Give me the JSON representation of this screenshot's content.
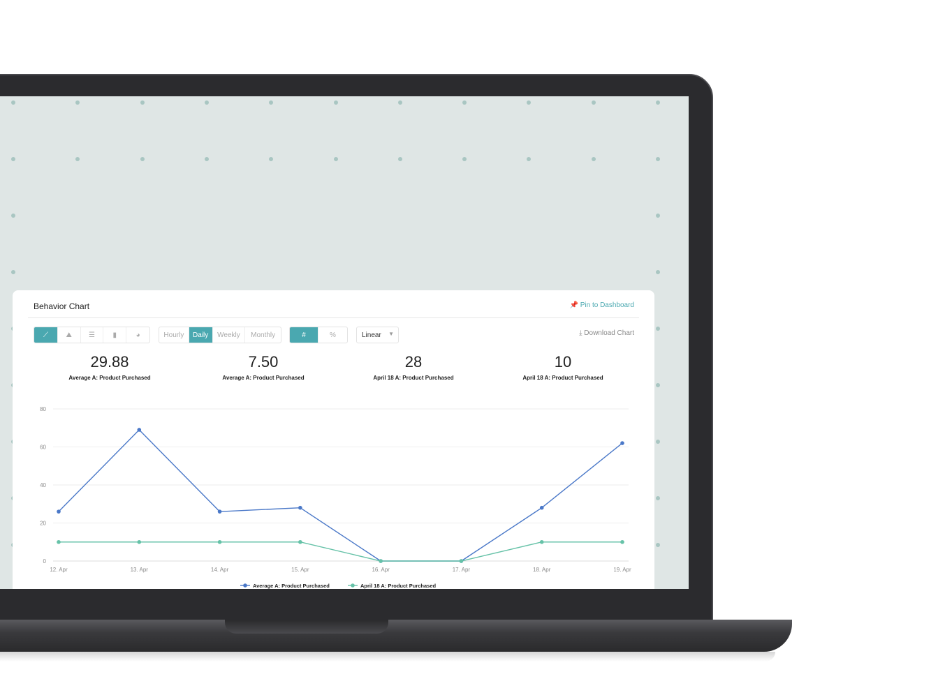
{
  "card": {
    "title": "Behavior Chart",
    "pin_label": "Pin to Dashboard",
    "download_label": "Download Chart"
  },
  "chart_types": [
    "line-chart-icon",
    "area-chart-icon",
    "table-icon",
    "bar-chart-icon",
    "pie-chart-icon"
  ],
  "intervals": [
    "Hourly",
    "Daily",
    "Weekly",
    "Monthly"
  ],
  "active_interval": "Daily",
  "units": [
    "#",
    "%"
  ],
  "active_unit": "#",
  "scale": "Linear",
  "stats": [
    {
      "value": "29.88",
      "label": "Average A: Product Purchased"
    },
    {
      "value": "7.50",
      "label": "Average A: Product Purchased"
    },
    {
      "value": "28",
      "label": "April 18 A: Product Purchased"
    },
    {
      "value": "10",
      "label": "April 18 A: Product Purchased"
    }
  ],
  "chart_data": {
    "type": "line",
    "categories": [
      "12. Apr",
      "13. Apr",
      "14. Apr",
      "15. Apr",
      "16. Apr",
      "17. Apr",
      "18. Apr",
      "19. Apr"
    ],
    "ylim": [
      0,
      80
    ],
    "yticks": [
      0,
      20,
      40,
      60,
      80
    ],
    "grid": true,
    "legend": "bottom",
    "series": [
      {
        "name": "Average A: Product Purchased",
        "color": "#4a78c8",
        "values": [
          26,
          69,
          26,
          28,
          0,
          0,
          28,
          62
        ]
      },
      {
        "name": "April 18 A: Product Purchased",
        "color": "#66c2a8",
        "values": [
          10,
          10,
          10,
          10,
          0,
          0,
          10,
          10
        ]
      }
    ]
  },
  "colors": {
    "accent": "#4aa8b0"
  }
}
